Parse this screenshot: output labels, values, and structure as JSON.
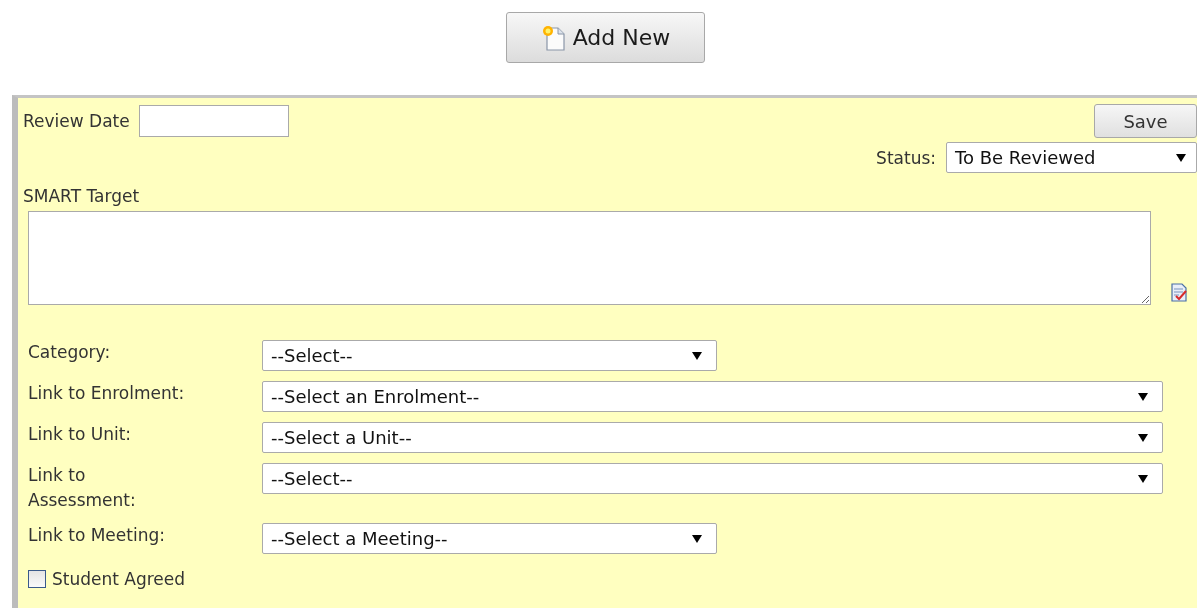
{
  "add_new_button": {
    "label": "Add New"
  },
  "form": {
    "review_date": {
      "label": "Review Date"
    },
    "save_button": {
      "label": "Save"
    },
    "status": {
      "label": "Status:",
      "value": "To Be Reviewed"
    },
    "smart_target": {
      "label": "SMART Target"
    },
    "fields": [
      {
        "label": "Category:",
        "value": "--Select--",
        "kind": "short"
      },
      {
        "label": "Link to Enrolment:",
        "value": "--Select an Enrolment--",
        "kind": "wide"
      },
      {
        "label": "Link to Unit:",
        "value": "--Select a Unit--",
        "kind": "wide"
      },
      {
        "label": "Link to Assessment:",
        "value": "--Select--",
        "kind": "wide"
      },
      {
        "label": "Link to Meeting:",
        "value": "--Select a Meeting--",
        "kind": "short"
      }
    ],
    "student_agreed": {
      "label": "Student Agreed",
      "checked": false
    }
  }
}
